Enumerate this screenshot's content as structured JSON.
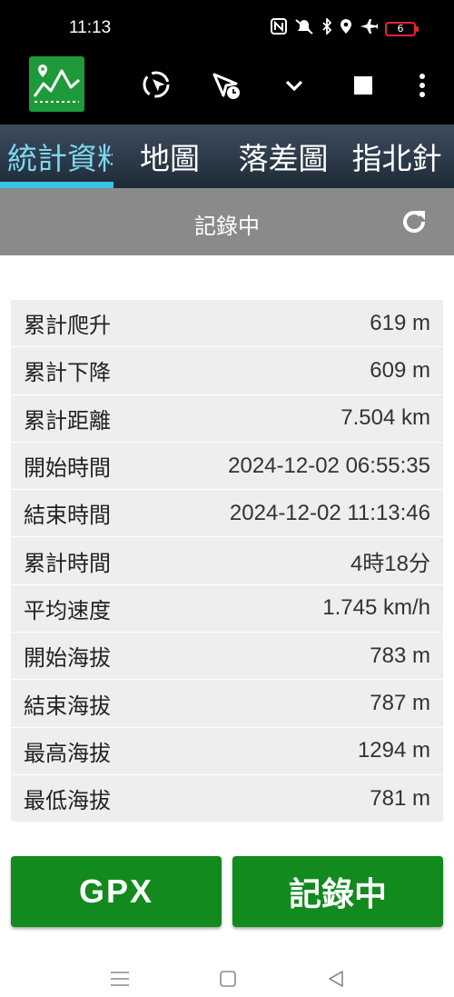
{
  "status_bar": {
    "time": "11:13",
    "battery_level": "6",
    "icons": [
      "nfc-icon",
      "mute-icon",
      "bluetooth-icon",
      "location-icon",
      "airplane-icon"
    ]
  },
  "toolbar": {
    "icons": [
      "app-logo-icon",
      "cursor-location-icon",
      "navigation-clock-icon",
      "chevron-down-icon",
      "stop-icon",
      "more-vert-icon"
    ]
  },
  "tabs": [
    {
      "label": "統計資料"
    },
    {
      "label": "地圖"
    },
    {
      "label": "落差圖"
    },
    {
      "label": "指北針"
    }
  ],
  "recording_bar": {
    "title": "記錄中"
  },
  "stats": [
    {
      "label": "累計爬升",
      "value": "619 m"
    },
    {
      "label": "累計下降",
      "value": "609 m"
    },
    {
      "label": "累計距離",
      "value": "7.504 km"
    },
    {
      "label": "開始時間",
      "value": "2024-12-02 06:55:35"
    },
    {
      "label": "結束時間",
      "value": "2024-12-02 11:13:46"
    },
    {
      "label": "累計時間",
      "value": "4時18分"
    },
    {
      "label": "平均速度",
      "value": "1.745 km/h"
    },
    {
      "label": "開始海拔",
      "value": "783 m"
    },
    {
      "label": "結束海拔",
      "value": "787 m"
    },
    {
      "label": "最高海拔",
      "value": "1294 m"
    },
    {
      "label": "最低海拔",
      "value": "781 m"
    }
  ],
  "buttons": {
    "gpx": "GPX",
    "recording": "記錄中"
  },
  "colors": {
    "accent": "#39c3e6",
    "button_green": "#128a1e",
    "logo_green": "#1f9a3a"
  }
}
